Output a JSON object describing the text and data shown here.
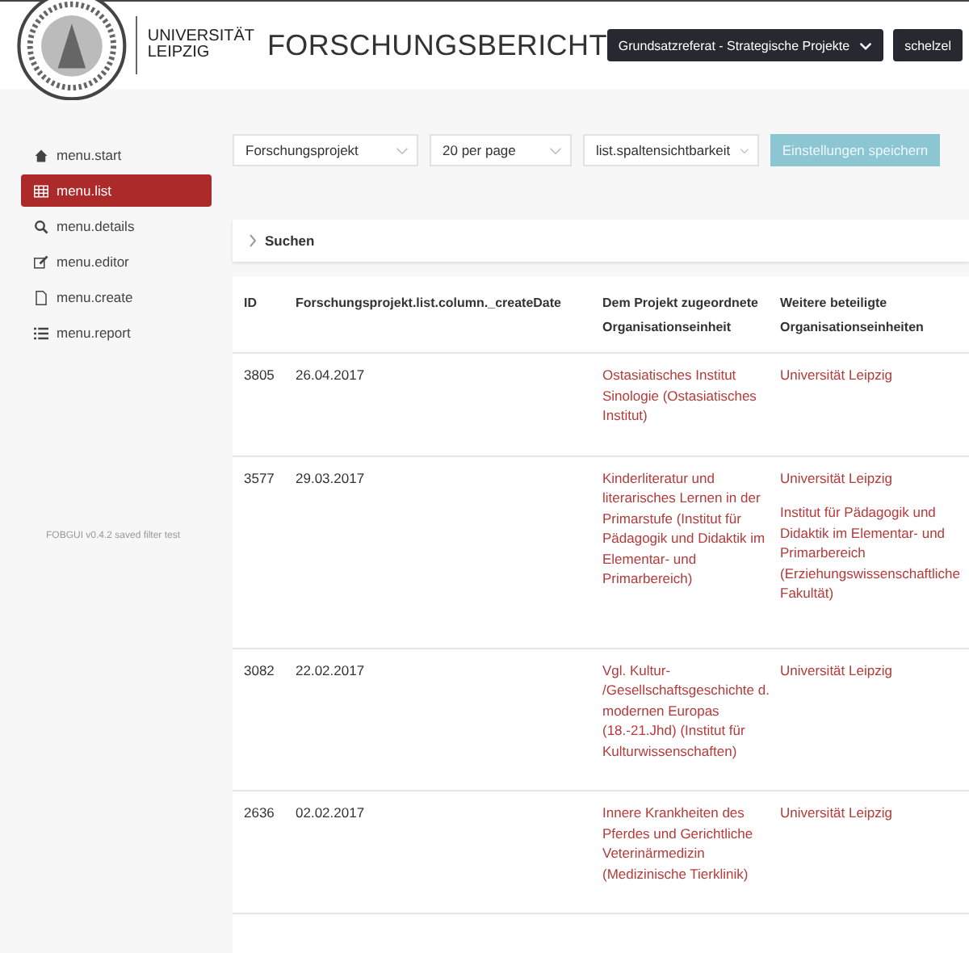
{
  "header": {
    "logo_text": [
      "UNIVERSITÄT",
      "LEIPZIG"
    ],
    "title": "FORSCHUNGSBERICHT",
    "unit_dropdown": "Grundsatzreferat - Strategische Projekte",
    "user_button": "schelzel"
  },
  "sidebar": {
    "items": [
      {
        "label": "menu.start",
        "selected": false
      },
      {
        "label": "menu.list",
        "selected": true
      },
      {
        "label": "menu.details",
        "selected": false
      },
      {
        "label": "menu.editor",
        "selected": false
      },
      {
        "label": "menu.create",
        "selected": false
      },
      {
        "label": "menu.report",
        "selected": false
      }
    ],
    "footer": "FOBGUI v0.4.2 saved filter test"
  },
  "toolbar": {
    "selects": [
      "Forschungsprojekt",
      "20 per page",
      "list.spaltensichtbarkeit"
    ],
    "save_button": {
      "label": "Einstellungen speichern",
      "disabled": true
    }
  },
  "search_panel": {
    "label": "Suchen",
    "expanded": false
  },
  "table": {
    "columns": [
      "ID",
      "Forschungsprojekt.list.column._createDate",
      "Dem Projekt zugeordnete Organisationseinheit",
      "Weitere beteiligte Organisationseinheiten"
    ],
    "rows": [
      {
        "id": "3805",
        "date": "26.04.2017",
        "unit": "Ostasiatisches Institut Sinologie (Ostasiatisches Institut)",
        "other_units": [
          "Universität Leipzig"
        ]
      },
      {
        "id": "3577",
        "date": "29.03.2017",
        "unit": "Kinderliteratur und literarisches Lernen in der Primarstufe (Institut für Pädagogik und Didaktik im Elementar- und Primarbereich)",
        "other_units": [
          "Universität Leipzig",
          "Institut für Pädagogik und Didaktik im Elementar- und Primarbereich (Erziehungswissenschaftliche Fakultät)"
        ]
      },
      {
        "id": "3082",
        "date": "22.02.2017",
        "unit": "Vgl. Kultur- /Gesellschaftsgeschichte d. modernen Europas (18.-21.Jhd) (Institut für Kulturwissenschaften)",
        "other_units": [
          "Universität Leipzig"
        ]
      },
      {
        "id": "2636",
        "date": "02.02.2017",
        "unit": "Innere Krankheiten des Pferdes und Gerichtliche Veterinärmedizin (Medizinische Tierklinik)",
        "other_units": [
          "Universität Leipzig"
        ]
      }
    ]
  }
}
